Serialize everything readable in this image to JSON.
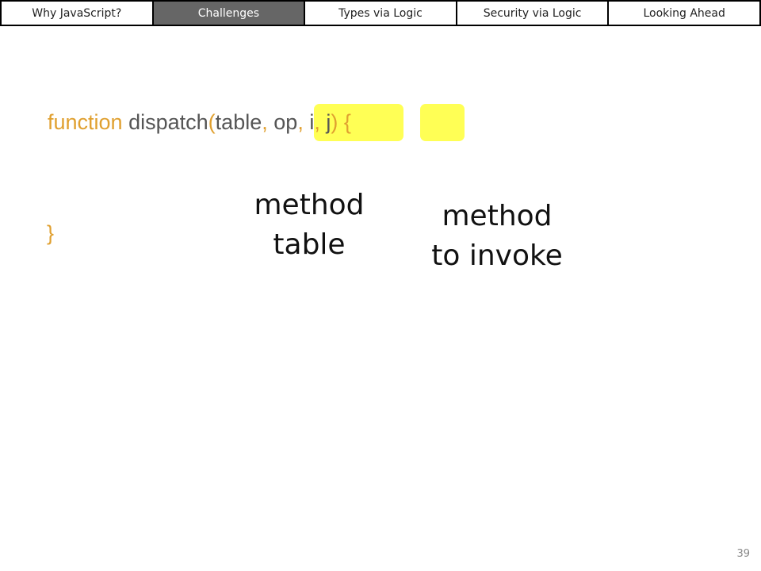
{
  "nav": {
    "tabs": [
      {
        "label": "Why JavaScript?",
        "active": false
      },
      {
        "label": "Challenges",
        "active": true
      },
      {
        "label": "Types via Logic",
        "active": false
      },
      {
        "label": "Security via Logic",
        "active": false
      },
      {
        "label": "Looking Ahead",
        "active": false
      }
    ]
  },
  "code": {
    "keyword": "function",
    "fn_name": "dispatch",
    "open_paren": "(",
    "param_table": "table",
    "comma1": ",",
    "param_op": "op",
    "comma2": ",",
    "param_i": "i",
    "comma3": ",",
    "param_j": "j",
    "close_paren": ")",
    "open_brace": "{",
    "close_brace": "}"
  },
  "callouts": {
    "method_table_line1": "method",
    "method_table_line2": "table",
    "method_invoke_line1": "method",
    "method_invoke_line2": "to invoke"
  },
  "colors": {
    "highlight": "#ffff55",
    "keyword": "#e0a030",
    "identifier": "#555555",
    "active_tab": "#666666"
  },
  "slide_number": "39"
}
